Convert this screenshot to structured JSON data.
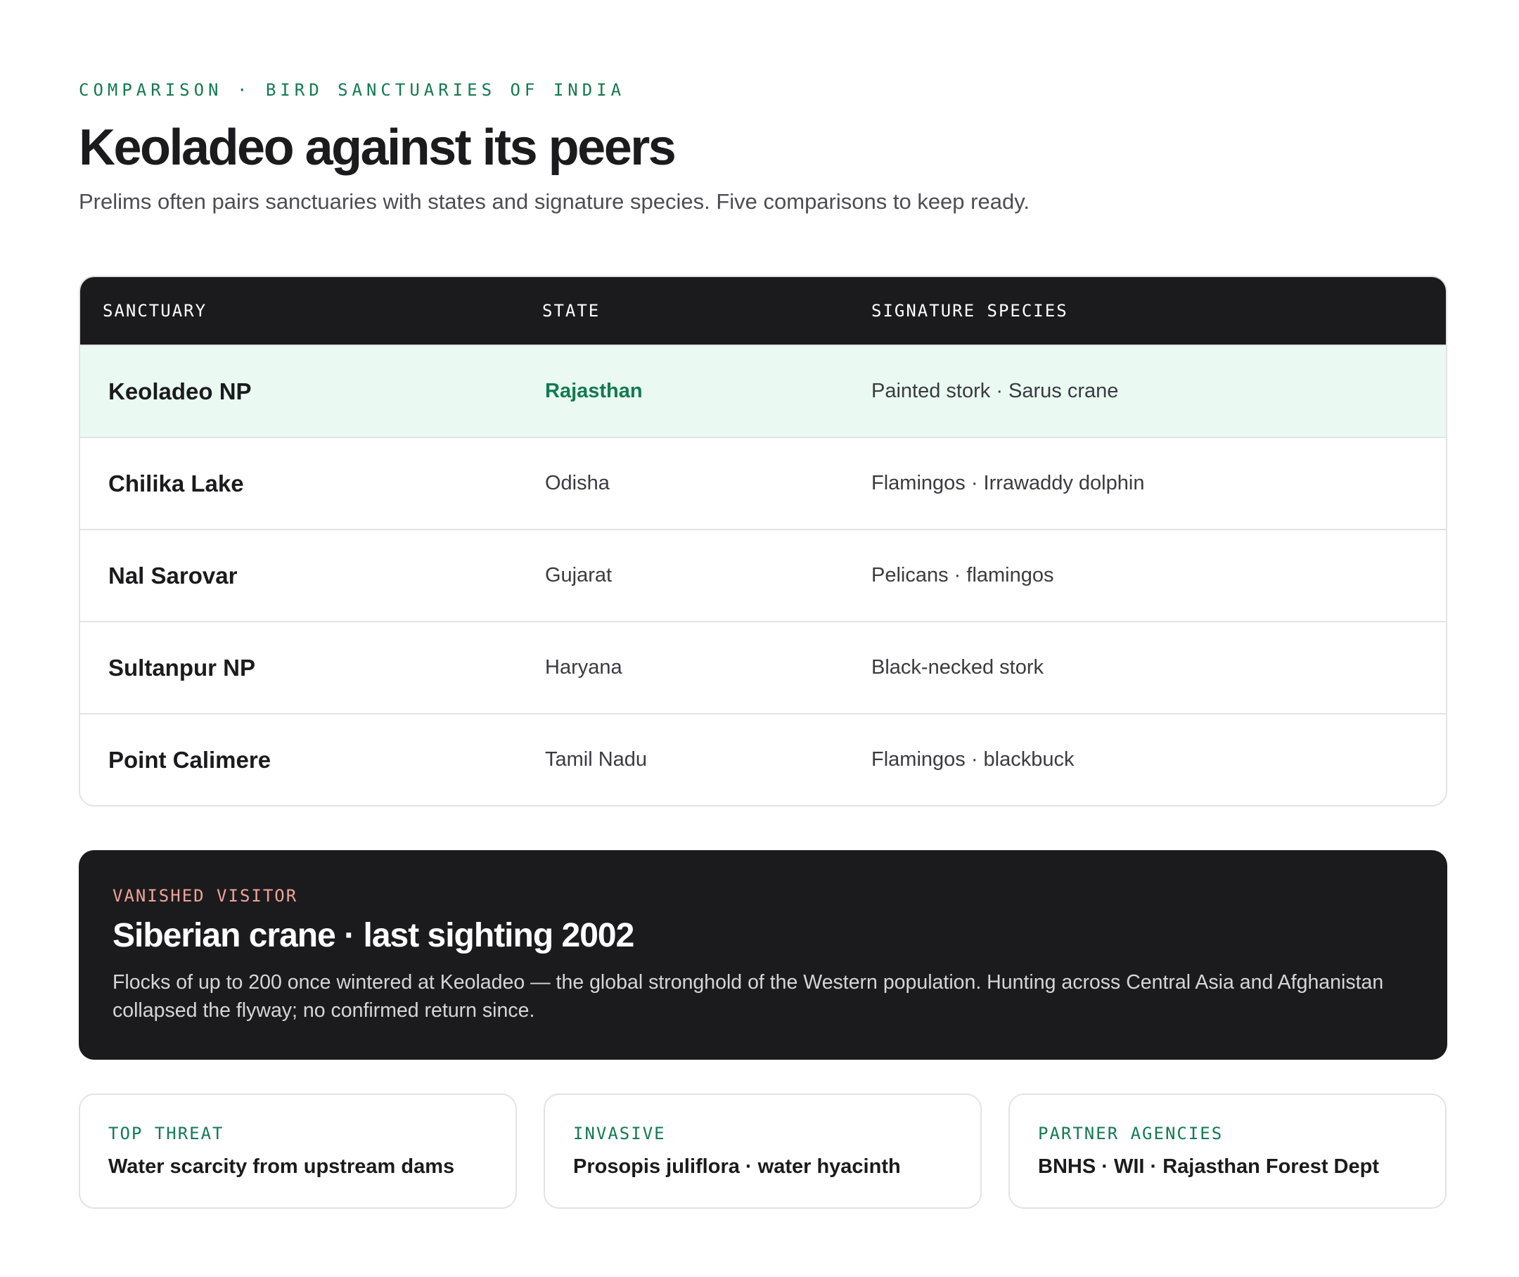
{
  "header": {
    "eyebrow": "COMPARISON · BIRD SANCTUARIES OF INDIA",
    "title": "Keoladeo against its peers",
    "subtitle": "Prelims often pairs sanctuaries with states and signature species. Five comparisons to keep ready."
  },
  "table": {
    "columns": [
      "SANCTUARY",
      "STATE",
      "SIGNATURE SPECIES"
    ],
    "rows": [
      {
        "name": "Keoladeo NP",
        "state": "Rajasthan",
        "species": "Painted stork · Sarus crane",
        "highlighted": true
      },
      {
        "name": "Chilika Lake",
        "state": "Odisha",
        "species": "Flamingos · Irrawaddy dolphin"
      },
      {
        "name": "Nal Sarovar",
        "state": "Gujarat",
        "species": "Pelicans · flamingos"
      },
      {
        "name": "Sultanpur NP",
        "state": "Haryana",
        "species": "Black-necked stork"
      },
      {
        "name": "Point Calimere",
        "state": "Tamil Nadu",
        "species": "Flamingos · blackbuck"
      }
    ]
  },
  "callout": {
    "eyebrow": "VANISHED VISITOR",
    "title": "Siberian crane · last sighting 2002",
    "body": "Flocks of up to 200 once wintered at Keoladeo — the global stronghold of the Western population. Hunting across Central Asia and Afghanistan collapsed the flyway; no confirmed return since."
  },
  "cards": [
    {
      "label": "TOP THREAT",
      "value": "Water scarcity from upstream dams"
    },
    {
      "label": "INVASIVE",
      "value": "Prosopis juliflora · water hyacinth"
    },
    {
      "label": "PARTNER AGENCIES",
      "value": "BNHS · WII · Rajasthan Forest Dept"
    }
  ],
  "colors": {
    "accent_green": "#127a52",
    "highlight_row": "#eafaf2",
    "dark_panel": "#1b1b1d",
    "callout_eyebrow": "#f0a39a"
  }
}
